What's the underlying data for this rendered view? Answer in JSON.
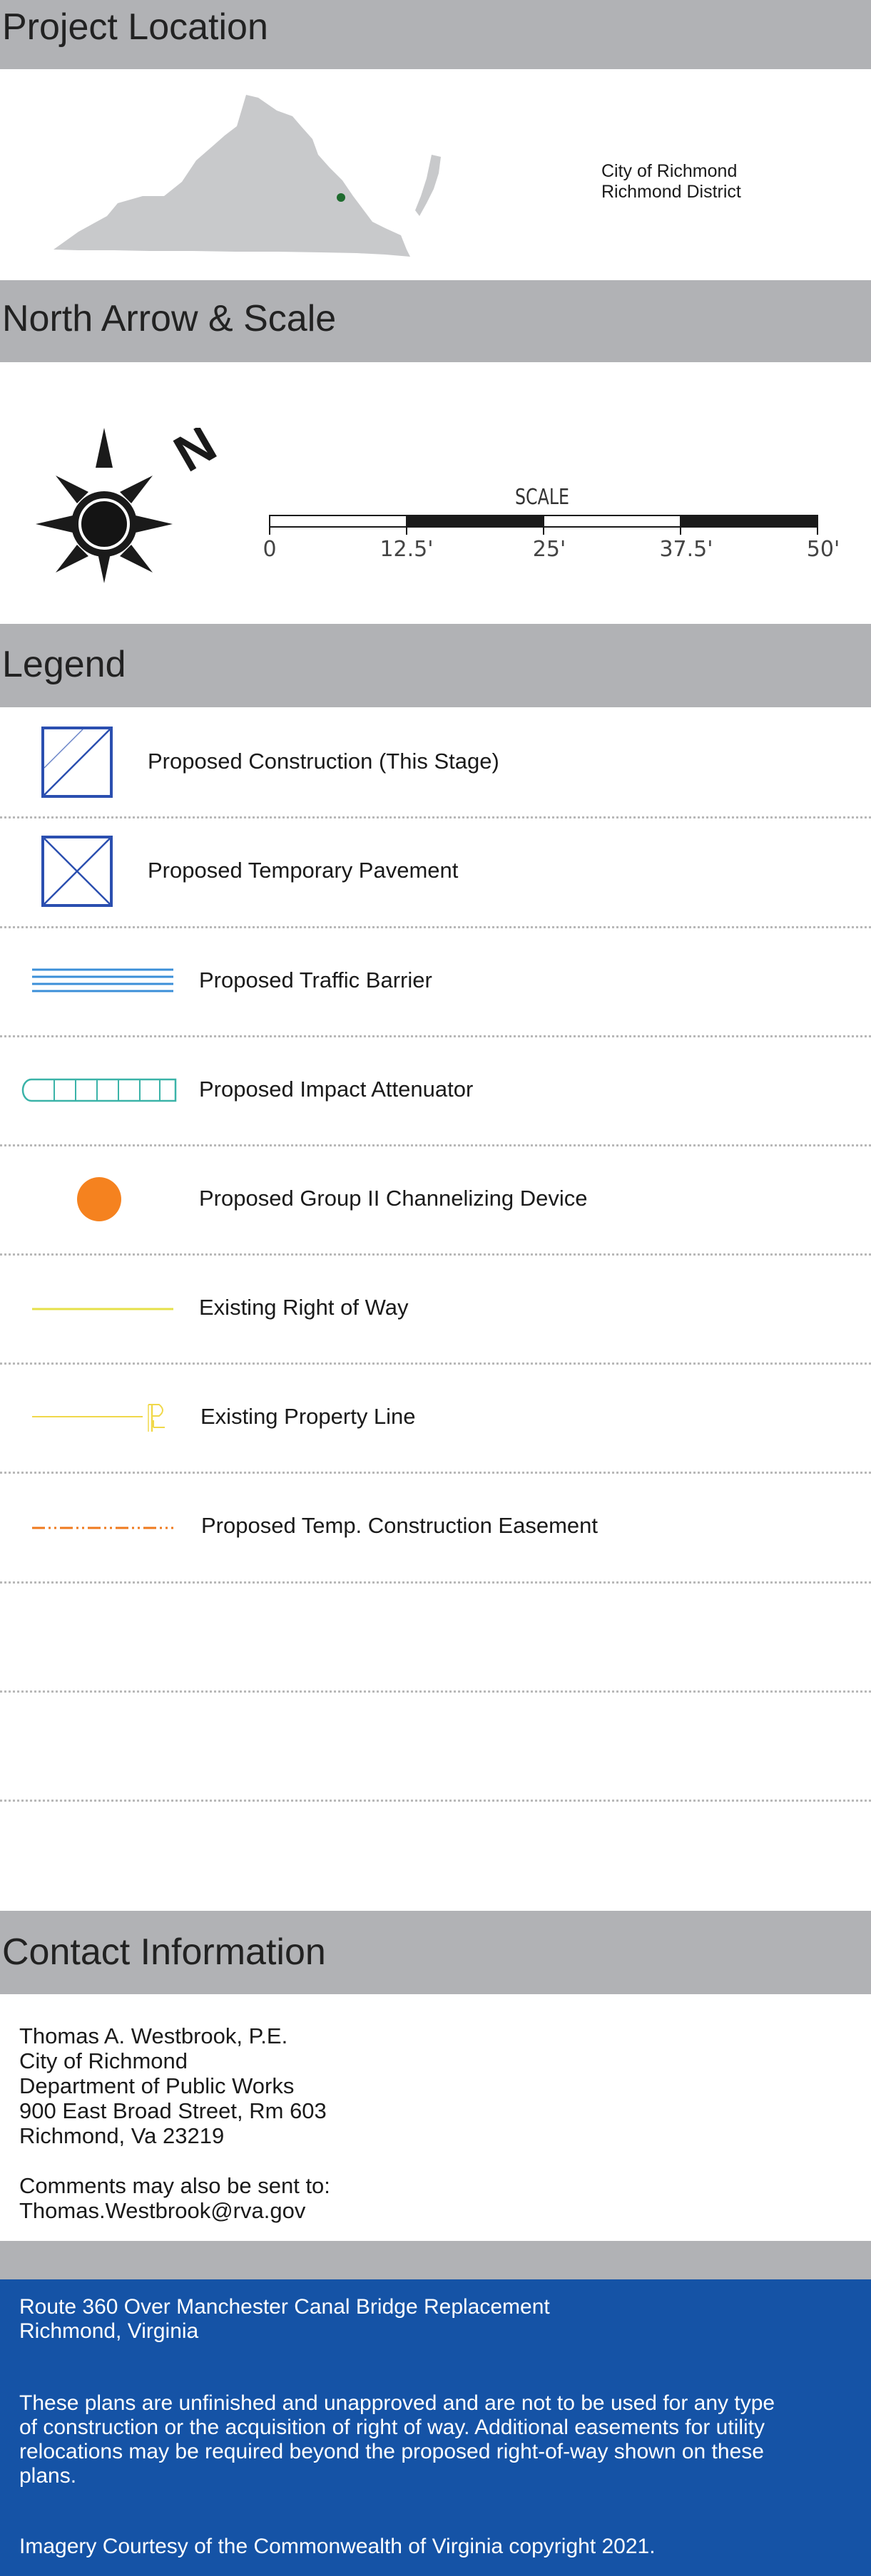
{
  "sections": {
    "project_location": "Project Location",
    "north_arrow_scale": "North Arrow & Scale",
    "legend": "Legend",
    "contact_information": "Contact Information"
  },
  "location": {
    "line1": "City of Richmond",
    "line2": "Richmond District",
    "map_color": "#c8c9cb",
    "marker_color": "#1e6b2e"
  },
  "north_arrow": {
    "letter": "N"
  },
  "scale": {
    "title": "SCALE",
    "ticks": [
      "0",
      "12.5'",
      "25'",
      "37.5'",
      "50'"
    ]
  },
  "legend": {
    "items": [
      {
        "label": "Proposed Construction (This Stage)",
        "icon": "hatched-square-icon"
      },
      {
        "label": "Proposed Temporary Pavement",
        "icon": "crossed-square-icon"
      },
      {
        "label": "Proposed Traffic Barrier",
        "icon": "traffic-barrier-icon"
      },
      {
        "label": "Proposed Impact Attenuator",
        "icon": "impact-attenuator-icon"
      },
      {
        "label": "Proposed Group II Channelizing Device",
        "icon": "orange-dot-icon"
      },
      {
        "label": "Existing Right of Way",
        "icon": "right-of-way-line-icon"
      },
      {
        "label": "Existing Property Line",
        "icon": "property-line-icon"
      },
      {
        "label": "Proposed Temp. Construction Easement",
        "icon": "easement-line-icon"
      }
    ],
    "colors": {
      "construction": "#2b4fb0",
      "barrier": "#3b8fd8",
      "attenuator": "#3ab3a8",
      "channelizing": "#f5821f",
      "right_of_way": "#e6e04a",
      "property_line": "#f0d84a",
      "easement": "#ef7a1e"
    }
  },
  "contact": {
    "name": "Thomas A. Westbrook, P.E.",
    "org": "City of Richmond",
    "dept": "Department of Public Works",
    "address": "900 East Broad Street, Rm 603",
    "city": "Richmond, Va 23219",
    "comments": "Comments may also be sent to:",
    "email": "Thomas.Westbrook@rva.gov"
  },
  "footer": {
    "project_line1": "Route 360 Over Manchester Canal Bridge Replacement",
    "project_line2": "Richmond, Virginia",
    "disclaimer_line1": "These plans are unfinished and unapproved and are not to be used for any type",
    "disclaimer_line2": "of construction or the acquisition of right of way.  Additional easements for utility",
    "disclaimer_line3": "relocations may be required beyond the proposed right-of-way shown on these",
    "disclaimer_line4": "plans.",
    "imagery": "Imagery Courtesy of the Commonwealth of Virginia copyright 2021.",
    "bg_color": "#1553a6"
  }
}
